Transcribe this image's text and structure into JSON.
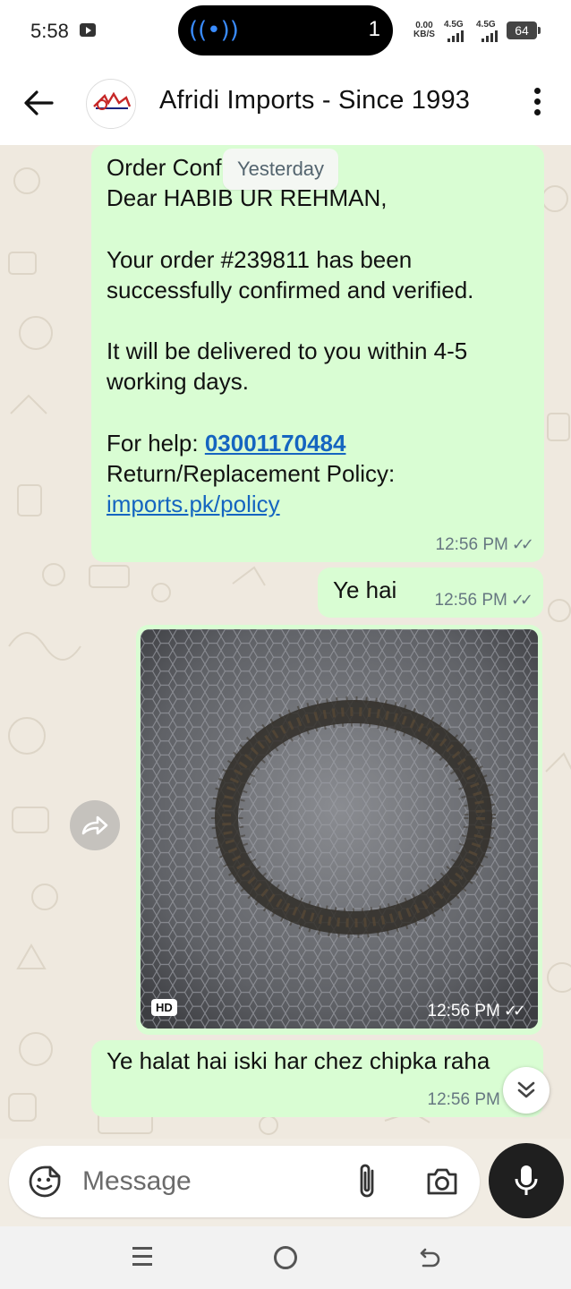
{
  "status_bar": {
    "time": "5:58",
    "live_count": "1",
    "net_speed_value": "0.00",
    "net_speed_unit": "KB/S",
    "sim1": "4.5G",
    "sim2": "4.5G",
    "battery": "64"
  },
  "header": {
    "title": "Afridi Imports - Since 1993"
  },
  "chat": {
    "date_chip": "Yesterday",
    "msg1": {
      "header": "Order Confirmed",
      "greeting": "Dear HABIB UR REHMAN,",
      "body1": "Your order #239811 has been successfully confirmed and verified.",
      "body2": "It will be delivered to you within 4-5 working days.",
      "help_label": "For help: ",
      "help_phone": "03001170484",
      "policy_label": "Return/Replacement Policy:",
      "policy_link": "imports.pk/policy",
      "time": "12:56 PM"
    },
    "msg2": {
      "text": "Ye hai",
      "time": "12:56 PM"
    },
    "msg3": {
      "hd": "HD",
      "time": "12:56 PM"
    },
    "msg4": {
      "text": "Ye halat hai iski har chez chipka raha",
      "time": "12:56 PM"
    }
  },
  "input": {
    "placeholder": "Message"
  },
  "icons": {
    "back": "arrow-left-icon",
    "menu": "more-vert-icon",
    "emoji": "sticker-icon",
    "attach": "paperclip-icon",
    "camera": "camera-icon",
    "mic": "microphone-icon",
    "forward": "forward-icon",
    "scroll": "double-chevron-down-icon"
  },
  "colors": {
    "outgoing_bubble": "#d9fdd3",
    "link": "#1565c0",
    "chat_background": "#efe9df",
    "tick": "#667781"
  }
}
